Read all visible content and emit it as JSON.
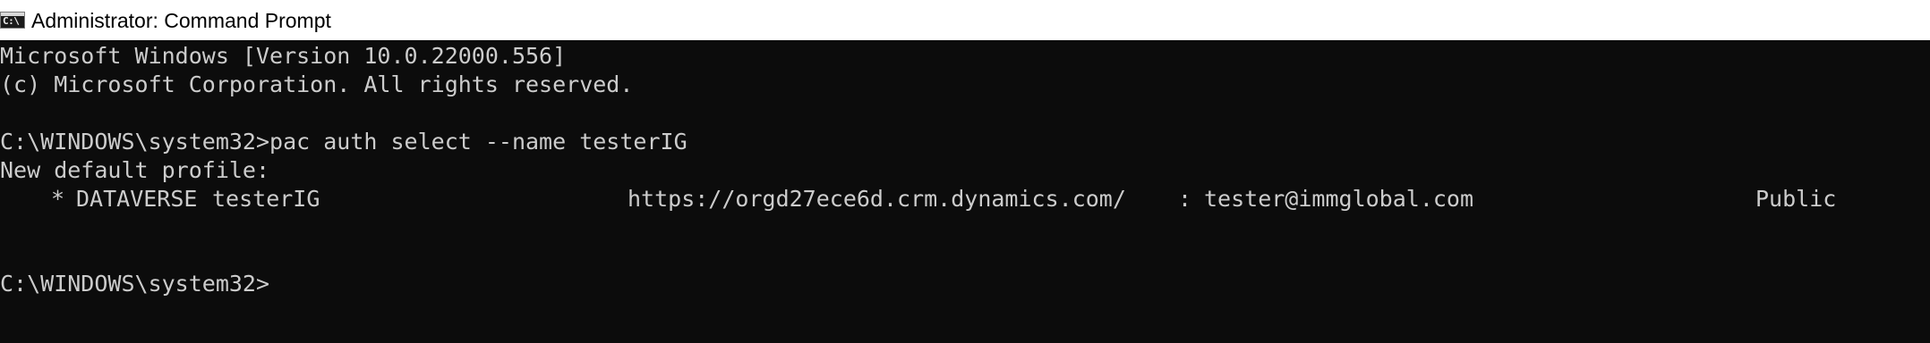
{
  "window": {
    "title": "Administrator: Command Prompt",
    "icon_glyph": "C:\\",
    "icon": "command-prompt-icon"
  },
  "console": {
    "version_line": "Microsoft Windows [Version 10.0.22000.556]",
    "copyright_line": "(c) Microsoft Corporation. All rights reserved.",
    "command_line": "C:\\WINDOWS\\system32>pac auth select --name testerIG",
    "profile_header": "New default profile:",
    "profile": {
      "marker": "*",
      "kind": "DATAVERSE",
      "name": "testerIG",
      "url": "https://orgd27ece6d.crm.dynamics.com/",
      "separator": ":",
      "user": "tester@immglobal.com",
      "cloud": "Public"
    },
    "prompt": "C:\\WINDOWS\\system32>"
  },
  "colors": {
    "console_background": "#0c0c0c",
    "console_text": "#cccccc",
    "titlebar_background": "#ffffff"
  }
}
